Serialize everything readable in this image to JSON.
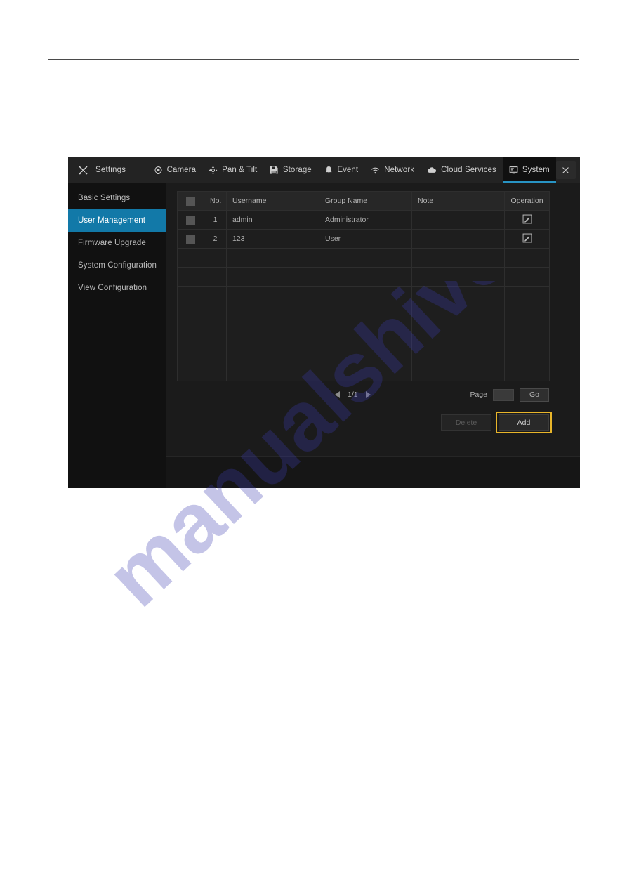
{
  "window": {
    "title": "Settings",
    "title_icon": "tools-icon",
    "close_icon": "close-icon",
    "tabs": [
      {
        "label": "Camera",
        "icon": "camera-icon",
        "active": false
      },
      {
        "label": "Pan & Tilt",
        "icon": "pan-tilt-icon",
        "active": false
      },
      {
        "label": "Storage",
        "icon": "storage-icon",
        "active": false
      },
      {
        "label": "Event",
        "icon": "bell-icon",
        "active": false
      },
      {
        "label": "Network",
        "icon": "wifi-icon",
        "active": false
      },
      {
        "label": "Cloud Services",
        "icon": "cloud-icon",
        "active": false
      },
      {
        "label": "System",
        "icon": "monitor-icon",
        "active": true
      }
    ]
  },
  "sidebar": {
    "items": [
      {
        "label": "Basic Settings",
        "active": false
      },
      {
        "label": "User Management",
        "active": true
      },
      {
        "label": "Firmware Upgrade",
        "active": false
      },
      {
        "label": "System Configuration",
        "active": false
      },
      {
        "label": "View Configuration",
        "active": false
      }
    ]
  },
  "table": {
    "headers": [
      "",
      "No.",
      "Username",
      "Group Name",
      "Note",
      "Operation"
    ],
    "rows": [
      {
        "no": "1",
        "username": "admin",
        "group": "Administrator",
        "note": "",
        "operation_icon": "edit-icon"
      },
      {
        "no": "2",
        "username": "123",
        "group": "User",
        "note": "",
        "operation_icon": "edit-icon"
      }
    ],
    "empty_row_count": 7
  },
  "pagination": {
    "prev_icon": "arrow-left-icon",
    "next_icon": "arrow-right-icon",
    "page_indicator": "1/1",
    "page_label": "Page",
    "page_value": "",
    "go_label": "Go"
  },
  "actions": {
    "delete_label": "Delete",
    "add_label": "Add"
  },
  "watermark": {
    "text": "manualshive.com"
  },
  "colors": {
    "accent_blue": "#1279a8",
    "tab_underline": "#2894c4",
    "focus_yellow": "#e8b52a",
    "window_bg": "#131313",
    "watermark": "#2f2f9e"
  }
}
